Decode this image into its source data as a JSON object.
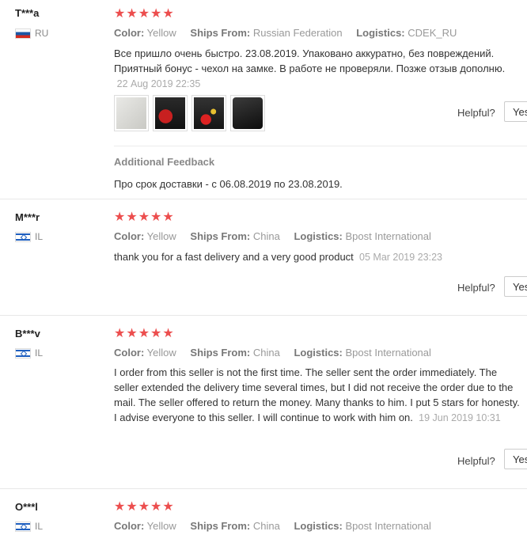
{
  "labels": {
    "color": "Color:",
    "ships_from": "Ships From:",
    "logistics": "Logistics:",
    "helpful": "Helpful?",
    "yes": "Yes",
    "additional_feedback": "Additional Feedback"
  },
  "rating_stars": "★★★★★",
  "reviews": [
    {
      "user": "T***a",
      "country": "RU",
      "rating": 5,
      "color": "Yellow",
      "ships_from": "Russian Federation",
      "logistics": "CDEK_RU",
      "text": "Все пришло очень быстро. 23.08.2019. Упаковано аккуратно, без повреждений. Приятный бонус - чехол на замке. В работе не проверяли. Позже отзыв дополню.",
      "date": "22 Aug 2019 22:35",
      "photos": [
        "photo-1",
        "photo-2",
        "photo-3",
        "photo-4"
      ],
      "additional_feedback": "Про срок доставки - с 06.08.2019 по 23.08.2019."
    },
    {
      "user": "M***r",
      "country": "IL",
      "rating": 5,
      "color": "Yellow",
      "ships_from": "China",
      "logistics": "Bpost International",
      "text": "thank you for a fast delivery and a very good product",
      "date": "05 Mar 2019 23:23"
    },
    {
      "user": "B***v",
      "country": "IL",
      "rating": 5,
      "color": "Yellow",
      "ships_from": "China",
      "logistics": "Bpost International",
      "text": "I order from this seller is not the first time. The seller sent the order immediately. The seller extended the delivery time several times, but I did not receive the order due to the mail. The seller offered to return the money. Many thanks to him. I put 5 stars for honesty. I advise everyone to this seller. I will continue to work with him on.",
      "date": "19 Jun 2019 10:31"
    },
    {
      "user": "O***l",
      "country": "IL",
      "rating": 5,
      "color": "Yellow",
      "ships_from": "China",
      "logistics": "Bpost International"
    }
  ],
  "colors": {
    "star": "#ec4e4e",
    "muted": "#999999",
    "separator": "#e8e8e8"
  }
}
